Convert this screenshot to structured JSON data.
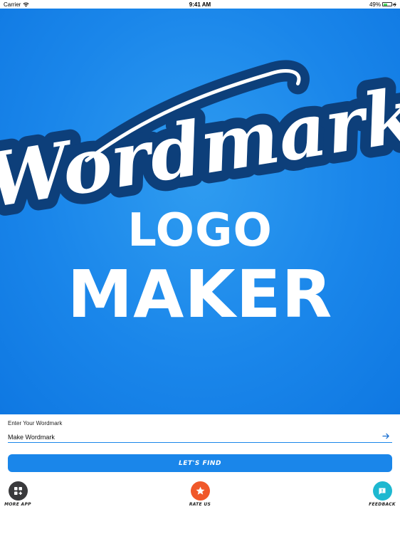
{
  "status_bar": {
    "carrier": "Carrier",
    "time": "9:41 AM",
    "battery_text": "49%",
    "battery_level": 0.49
  },
  "hero": {
    "script_word": "Wordmark",
    "line1": "LOGO",
    "line2": "MAKER",
    "colors": {
      "background": "#1a86ea",
      "script_fill": "#ffffff",
      "script_outline": "#0d3f7a"
    }
  },
  "form": {
    "label": "Enter Your Wordmark",
    "input_value": "Make Wordmark",
    "submit_icon": "arrow-right-icon",
    "find_button": "LET'S FIND"
  },
  "actions": [
    {
      "label": "MORE APP",
      "icon": "apps-grid-icon",
      "color": "#3a3a3c"
    },
    {
      "label": "RATE US",
      "icon": "star-icon",
      "color": "#f0582a"
    },
    {
      "label": "FEEDBACK",
      "icon": "chat-bubble-icon",
      "color": "#1eb8d0"
    }
  ]
}
